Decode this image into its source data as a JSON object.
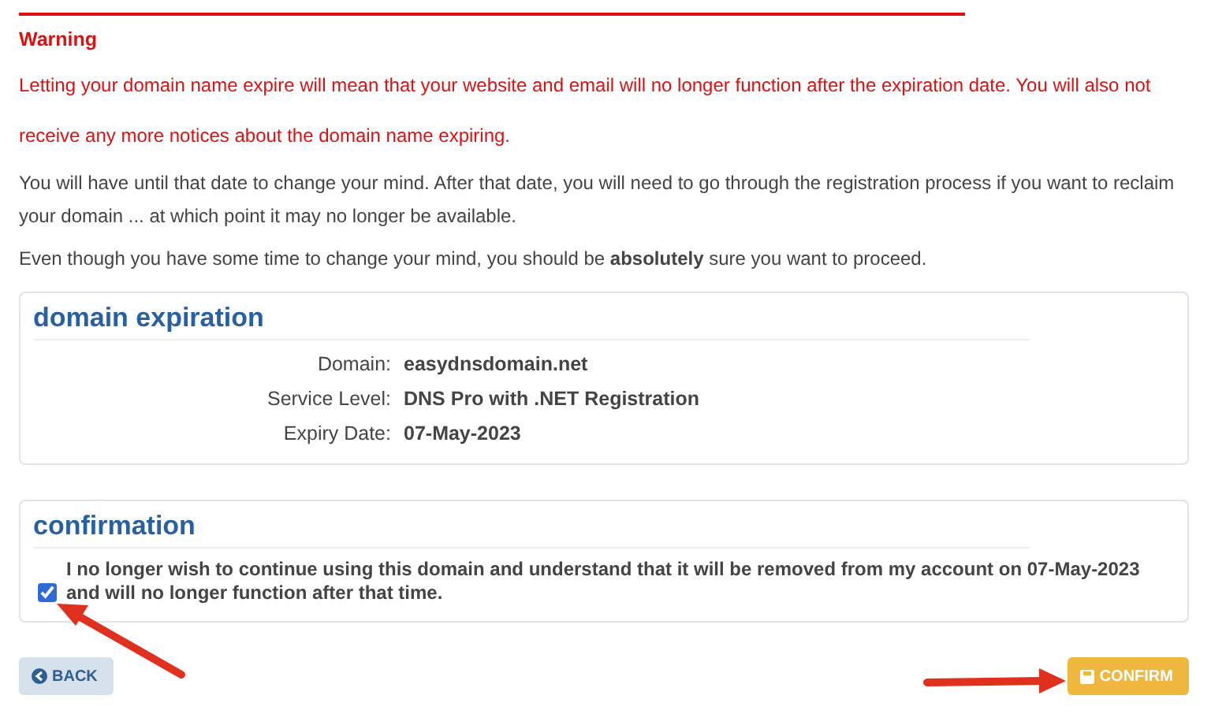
{
  "warning": {
    "title": "Warning",
    "message": "Letting your domain name expire will mean that your website and email will no longer function after the expiration date. You will also not receive any more notices about the domain name expiring."
  },
  "paragraphs": [
    "You will have until that date to change your mind. After that date, you will need to go through the registration process if you want to reclaim your domain ... at which point it may no longer be available.",
    "Even though you have some time to change your mind, you should be **absolutely** sure you want to proceed."
  ],
  "expiration": {
    "title": "domain expiration",
    "fields": [
      {
        "label": "Domain:",
        "value": "easydnsdomain.net"
      },
      {
        "label": "Service Level:",
        "value": "DNS Pro with .NET Registration"
      },
      {
        "label": "Expiry Date:",
        "value": "07-May-2023"
      }
    ]
  },
  "confirmation": {
    "title": "confirmation",
    "checked": true,
    "text": "I no longer wish to continue using this domain and understand that it will be removed from my account on 07-May-2023 and will no longer function after that time."
  },
  "buttons": {
    "back": "BACK",
    "confirm": "CONFIRM"
  }
}
